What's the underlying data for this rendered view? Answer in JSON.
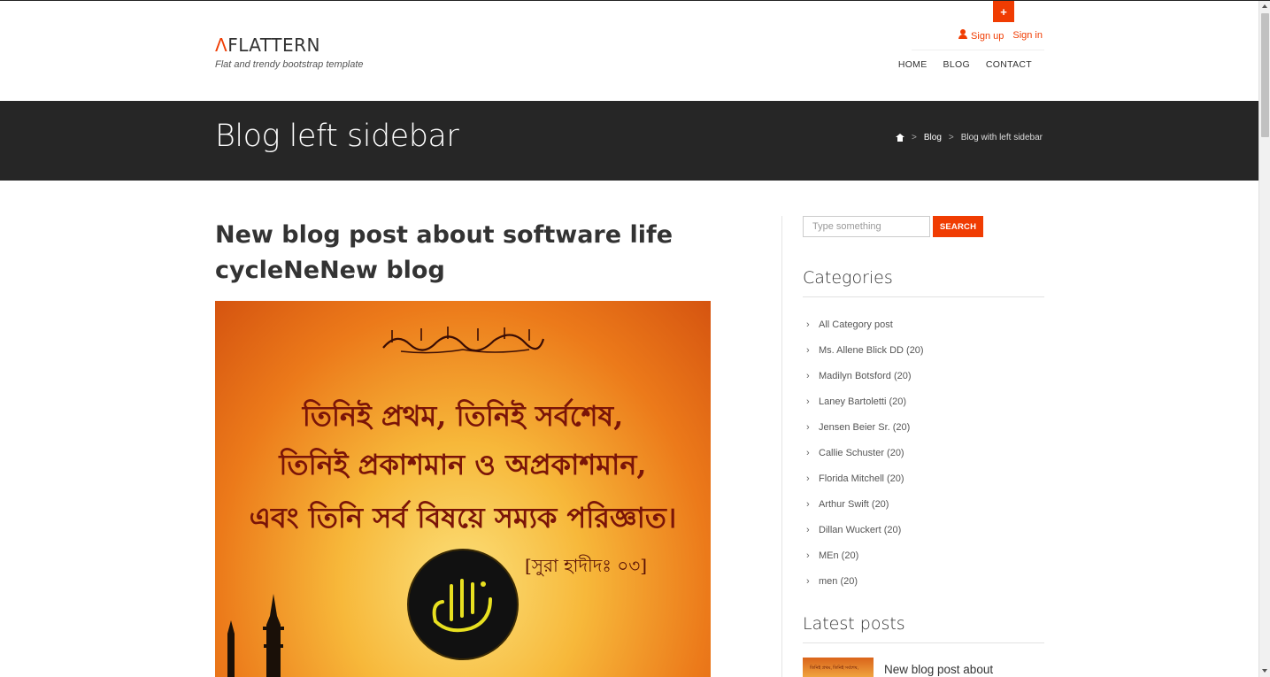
{
  "header": {
    "plus_label": "+",
    "logo_mark": "Λ",
    "logo_text": "FLATTERN",
    "tagline": "Flat and trendy bootstrap template",
    "signup_label": "Sign up",
    "signin_label": "Sign in",
    "nav": [
      "HOME",
      "BLOG",
      "CONTACT"
    ]
  },
  "title_bar": {
    "title": "Blog left sidebar",
    "breadcrumb": {
      "sep": ">",
      "blog": "Blog",
      "current": "Blog with left sidebar"
    }
  },
  "post": {
    "title": "New blog post about software life cycleNeNew blog",
    "image": {
      "line1": "তিনিই প্রথম, তিনিই সর্বশেষ,",
      "line2": "তিনিই প্রকাশমান ও অপ্রকাশমান,",
      "line3": "এবং তিনি সর্ব বিষয়ে সম্যক পরিজ্ঞাত।",
      "reference": "[সুরা হাদীদঃ ০৩]"
    }
  },
  "sidebar": {
    "search": {
      "placeholder": "Type something",
      "button_label": "SEARCH"
    },
    "categories_title": "Categories",
    "categories": [
      "All Category post",
      "Ms. Allene Blick DD (20)",
      "Madilyn Botsford (20)",
      "Laney Bartoletti (20)",
      "Jensen Beier Sr. (20)",
      "Callie Schuster (20)",
      "Florida Mitchell (20)",
      "Arthur Swift (20)",
      "Dillan Wuckert (20)",
      "MEn (20)",
      "men (20)"
    ],
    "latest_title": "Latest posts",
    "latest_posts": [
      {
        "title": "New blog post about",
        "thumb_text": "তিনিই প্রথম, তিনিই সর্বশেষ,"
      }
    ]
  },
  "colors": {
    "accent": "#f03c02",
    "title_bar_bg": "#262626"
  }
}
